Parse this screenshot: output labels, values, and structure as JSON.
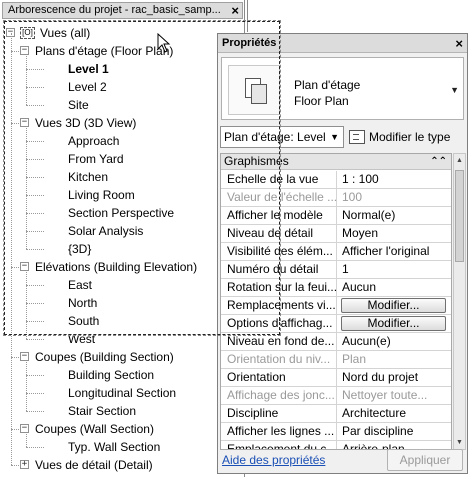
{
  "browser": {
    "title": "Arborescence du projet - rac_basic_samp...",
    "close_glyph": "×",
    "root": "Vues (all)",
    "nodes": [
      {
        "label": "Plans d'étage (Floor Plan)",
        "level": 1,
        "expander": "−"
      },
      {
        "label": "Level 1",
        "level": 2,
        "bold": true
      },
      {
        "label": "Level 2",
        "level": 2
      },
      {
        "label": "Site",
        "level": 2
      },
      {
        "label": "Vues 3D (3D View)",
        "level": 1,
        "expander": "−"
      },
      {
        "label": "Approach",
        "level": 2
      },
      {
        "label": "From Yard",
        "level": 2
      },
      {
        "label": "Kitchen",
        "level": 2
      },
      {
        "label": "Living Room",
        "level": 2
      },
      {
        "label": "Section Perspective",
        "level": 2
      },
      {
        "label": "Solar Analysis",
        "level": 2
      },
      {
        "label": "{3D}",
        "level": 2
      },
      {
        "label": "Elévations (Building Elevation)",
        "level": 1,
        "expander": "−"
      },
      {
        "label": "East",
        "level": 2
      },
      {
        "label": "North",
        "level": 2
      },
      {
        "label": "South",
        "level": 2
      },
      {
        "label": "West",
        "level": 2
      },
      {
        "label": "Coupes (Building Section)",
        "level": 1,
        "expander": "−"
      },
      {
        "label": "Building Section",
        "level": 2
      },
      {
        "label": "Longitudinal Section",
        "level": 2
      },
      {
        "label": "Stair Section",
        "level": 2
      },
      {
        "label": "Coupes (Wall Section)",
        "level": 1,
        "expander": "−"
      },
      {
        "label": "Typ. Wall Section",
        "level": 2
      },
      {
        "label": "Vues de détail (Detail)",
        "level": 1,
        "expander": "+"
      }
    ]
  },
  "properties": {
    "title": "Propriétés",
    "close_glyph": "×",
    "type_line1": "Plan d'étage",
    "type_line2": "Floor Plan",
    "instance_selector": "Plan d'étage: Level",
    "edit_type_label": "Modifier le type",
    "group_label": "Graphismes",
    "rows": [
      {
        "name": "Echelle de la vue",
        "value": "1 : 100"
      },
      {
        "name": "Valeur de l'échelle ...",
        "value": "100",
        "readonly": true
      },
      {
        "name": "Afficher le modèle",
        "value": "Normal(e)"
      },
      {
        "name": "Niveau de détail",
        "value": "Moyen"
      },
      {
        "name": "Visibilité des élém...",
        "value": "Afficher l'original"
      },
      {
        "name": "Numéro du détail",
        "value": "1"
      },
      {
        "name": "Rotation sur la feui...",
        "value": "Aucun"
      },
      {
        "name": "Remplacements vi...",
        "button": "Modifier..."
      },
      {
        "name": "Options d'affichag...",
        "button": "Modifier..."
      },
      {
        "name": "Niveau en fond de...",
        "value": "Aucun(e)"
      },
      {
        "name": "Orientation du niv...",
        "value": "Plan",
        "readonly": true
      },
      {
        "name": "Orientation",
        "value": "Nord du projet"
      },
      {
        "name": "Affichage des jonc...",
        "value": "Nettoyer toute...",
        "readonly": true
      },
      {
        "name": "Discipline",
        "value": "Architecture"
      },
      {
        "name": "Afficher les lignes ...",
        "value": "Par discipline"
      },
      {
        "name": "Emplacement du c...",
        "value": "Arrière-plan"
      }
    ],
    "help_link": "Aide des propriétés",
    "apply_button": "Appliquer"
  },
  "icons": {
    "close": "close-icon",
    "views_root": "views-root-icon",
    "type_thumbnail": "floor-plan-type-icon",
    "edit_type": "edit-type-icon",
    "collapse_group": "collapse-group-icon",
    "cursor": "mouse-pointer-icon"
  },
  "colors": {
    "title_bar": "#dcdcdc",
    "group_row": "#e4e4e4",
    "link": "#1a4fb5",
    "readonly_text": "#9a9a9a"
  }
}
